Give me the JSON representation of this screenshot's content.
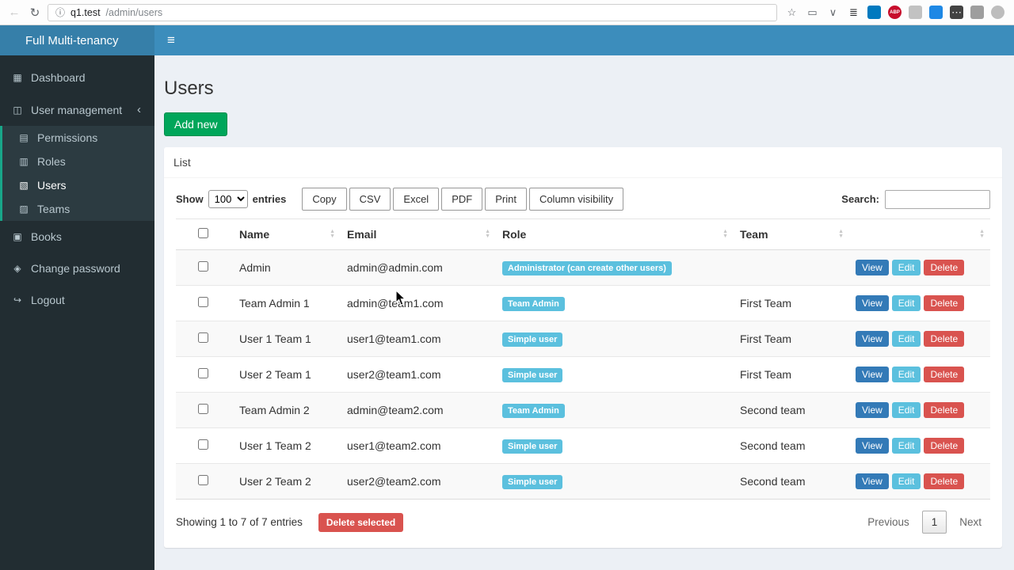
{
  "browser": {
    "back_icon": "←",
    "refresh_icon": "↻",
    "info_icon": "ⓘ",
    "url_host": "q1.test",
    "url_path": "/admin/users",
    "icons": [
      {
        "name": "star-icon",
        "glyph": "☆",
        "fg": "#5f6368",
        "bg": ""
      },
      {
        "name": "cast-icon",
        "glyph": "▭",
        "fg": "#5f6368",
        "bg": ""
      },
      {
        "name": "pocket-icon",
        "glyph": "∨",
        "fg": "#5f6368",
        "bg": ""
      },
      {
        "name": "layers-icon",
        "glyph": "≣",
        "fg": "#202124",
        "bg": ""
      },
      {
        "name": "trello-icon",
        "glyph": "",
        "fg": "#ffffff",
        "bg": "#0079bf"
      },
      {
        "name": "adblock-icon",
        "glyph": "ABP",
        "fg": "#ffffff",
        "bg": "#c70d2c",
        "round": true
      },
      {
        "name": "clip-icon",
        "glyph": "",
        "fg": "#ffffff",
        "bg": "#c2c2c2"
      },
      {
        "name": "ft-icon",
        "glyph": "",
        "fg": "#ffffff",
        "bg": "#1e88e5"
      },
      {
        "name": "more-tools-icon",
        "glyph": "⋯",
        "fg": "#ffffff",
        "bg": "#424242"
      },
      {
        "name": "gray-square-icon",
        "glyph": "",
        "fg": "#ffffff",
        "bg": "#9e9e9e"
      },
      {
        "name": "gray-circle-icon",
        "glyph": "",
        "fg": "#ffffff",
        "bg": "#bdbdbd",
        "round": true
      }
    ]
  },
  "header": {
    "brand": "Full Multi-tenancy",
    "menu_icon": "≡"
  },
  "sidebar": {
    "chevron": "‹",
    "items": [
      {
        "label": "Dashboard",
        "glyph": "▦"
      },
      {
        "label": "User management",
        "glyph": "◫"
      },
      {
        "label": "Permissions",
        "glyph": "▤"
      },
      {
        "label": "Roles",
        "glyph": "▥"
      },
      {
        "label": "Users",
        "glyph": "▧"
      },
      {
        "label": "Teams",
        "glyph": "▨"
      },
      {
        "label": "Books",
        "glyph": "▣"
      },
      {
        "label": "Change password",
        "glyph": "◈"
      },
      {
        "label": "Logout",
        "glyph": "↪"
      }
    ]
  },
  "page": {
    "title": "Users",
    "add_button": "Add new",
    "panel_title": "List"
  },
  "controls": {
    "show_label": "Show",
    "entries_value": "100",
    "entries_label": "entries",
    "export_buttons": [
      "Copy",
      "CSV",
      "Excel",
      "PDF",
      "Print",
      "Column visibility"
    ],
    "search_label": "Search:"
  },
  "table": {
    "columns": [
      "Name",
      "Email",
      "Role",
      "Team"
    ],
    "action_labels": [
      "View",
      "Edit",
      "Delete"
    ],
    "rows": [
      {
        "name": "Admin",
        "email": "admin@admin.com",
        "role": "Administrator (can create other users)",
        "team": ""
      },
      {
        "name": "Team Admin 1",
        "email": "admin@team1.com",
        "role": "Team Admin",
        "team": "First Team"
      },
      {
        "name": "User 1 Team 1",
        "email": "user1@team1.com",
        "role": "Simple user",
        "team": "First Team"
      },
      {
        "name": "User 2 Team 1",
        "email": "user2@team1.com",
        "role": "Simple user",
        "team": "First Team"
      },
      {
        "name": "Team Admin 2",
        "email": "admin@team2.com",
        "role": "Team Admin",
        "team": "Second team"
      },
      {
        "name": "User 1 Team 2",
        "email": "user1@team2.com",
        "role": "Simple user",
        "team": "Second team"
      },
      {
        "name": "User 2 Team 2",
        "email": "user2@team2.com",
        "role": "Simple user",
        "team": "Second team"
      }
    ]
  },
  "footer": {
    "summary": "Showing 1 to 7 of 7 entries",
    "delete_selected": "Delete selected",
    "pagination": {
      "previous": "Previous",
      "page": "1",
      "next": "Next"
    }
  },
  "colors": {
    "navbar": "#3c8dbc",
    "brand_bg": "#367fa9",
    "sidebar_bg": "#222d32",
    "submenu_bg": "#2c3b41",
    "content_bg": "#ecf0f5",
    "add_button": "#00a65a",
    "badge": "#5bc0de",
    "view_button": "#337ab7",
    "edit_button": "#5bc0de",
    "delete_button": "#d9534f"
  }
}
